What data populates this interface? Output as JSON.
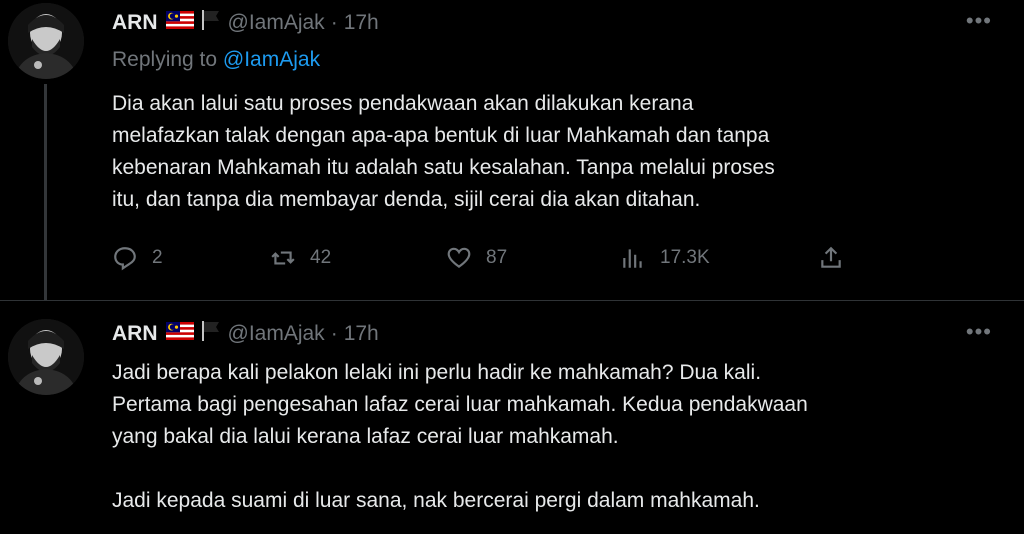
{
  "colors": {
    "background": "#000000",
    "text": "#e7e9ea",
    "muted": "#71767b",
    "link": "#1d9bf0",
    "divider": "#2f3336"
  },
  "tweets": [
    {
      "author": "ARN",
      "handle": "@IamAjak",
      "separator": "·",
      "time": "17h",
      "flags": [
        "malaysia-flag-icon",
        "black-flag-icon"
      ],
      "replying_prefix": "Replying to",
      "replying_handle": "@IamAjak",
      "text": [
        "Dia akan lalui satu proses pendakwaan akan dilakukan kerana",
        "melafazkan talak dengan apa-apa bentuk di luar Mahkamah dan tanpa",
        "kebenaran Mahkamah itu adalah satu kesalahan. Tanpa melalui proses",
        "itu, dan tanpa dia membayar denda, sijil cerai dia akan ditahan."
      ],
      "stats": {
        "replies": "2",
        "retweets": "42",
        "likes": "87",
        "views": "17.3K"
      }
    },
    {
      "author": "ARN",
      "handle": "@IamAjak",
      "separator": "·",
      "time": "17h",
      "flags": [
        "malaysia-flag-icon",
        "black-flag-icon"
      ],
      "text": [
        "Jadi berapa kali pelakon lelaki ini perlu hadir ke mahkamah? Dua kali.",
        "Pertama bagi pengesahan lafaz cerai luar mahkamah. Kedua pendakwaan",
        "yang bakal dia lalui kerana lafaz cerai luar mahkamah.",
        "",
        "Jadi kepada suami di luar sana, nak bercerai pergi dalam mahkamah."
      ]
    }
  ]
}
